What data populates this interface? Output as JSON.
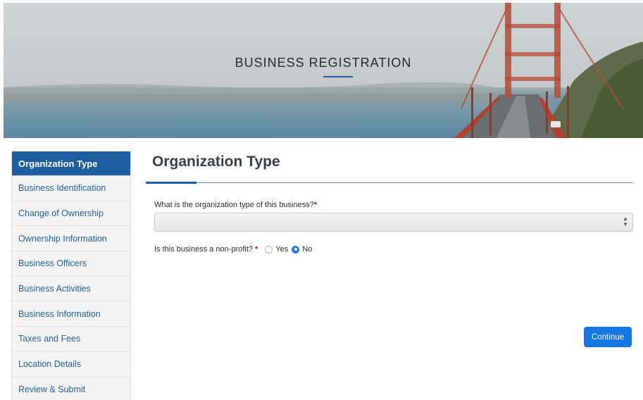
{
  "hero": {
    "title": "BUSINESS REGISTRATION"
  },
  "sidebar": {
    "items": [
      {
        "label": "Organization Type",
        "active": true
      },
      {
        "label": "Business Identification"
      },
      {
        "label": "Change of Ownership"
      },
      {
        "label": "Ownership Information"
      },
      {
        "label": "Business Officers"
      },
      {
        "label": "Business Activities"
      },
      {
        "label": "Business Information"
      },
      {
        "label": "Taxes and Fees"
      },
      {
        "label": "Location Details"
      },
      {
        "label": "Review & Submit"
      }
    ]
  },
  "main": {
    "title": "Organization Type",
    "org_type_question": "What is the organization type of this business?",
    "org_type_required": "*",
    "org_type_value": "",
    "nonprofit_question": "Is this business a non-profit?",
    "nonprofit_required": "*",
    "nonprofit_options": {
      "yes": "Yes",
      "no": "No"
    },
    "nonprofit_selected": "No",
    "continue_label": "Continue"
  },
  "colors": {
    "primary": "#1f5e9e",
    "button": "#1676e3",
    "required": "#d10f0f"
  }
}
